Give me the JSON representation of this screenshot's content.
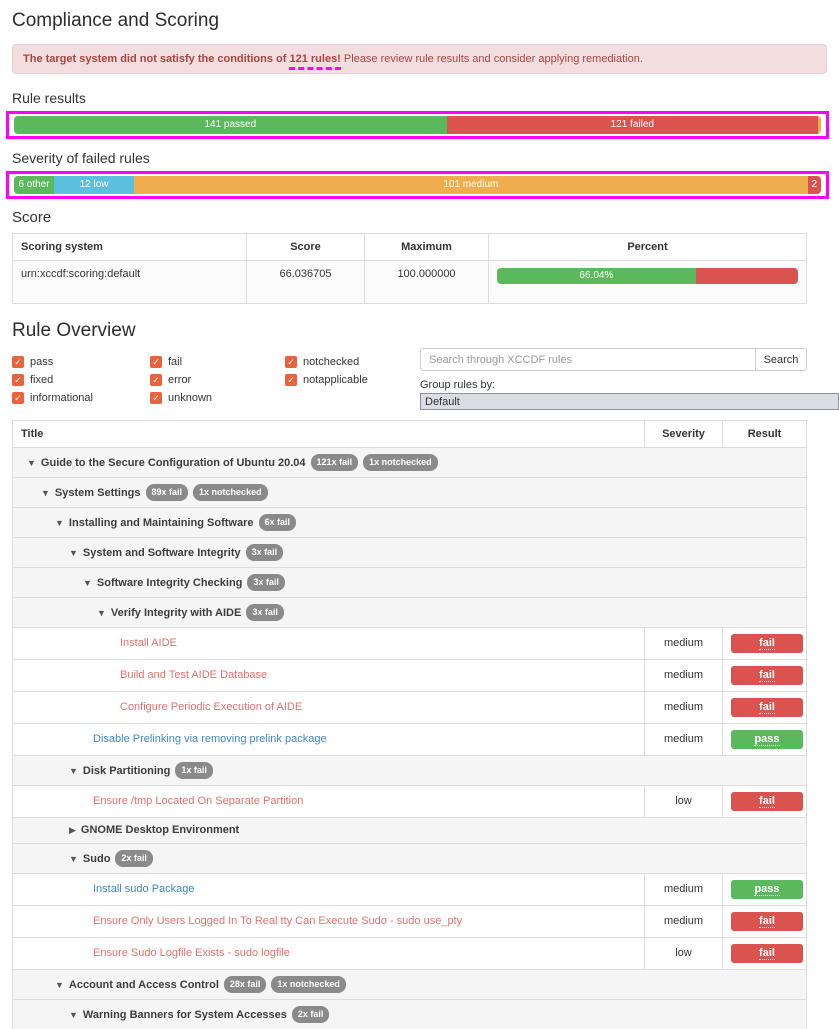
{
  "page_title": "Compliance and Scoring",
  "colors": {
    "pass_green": "#5cb85c",
    "fail_red": "#d9534f",
    "warning_orange": "#f0ad4e",
    "info_blue": "#5bc0de",
    "checkbox_orange": "#e8643c",
    "annotation_magenta": "#ff00ff",
    "badge_gray": "#8a8a8a",
    "alert_bg": "#f2dede",
    "alert_border": "#ebccd1",
    "alert_text": "#a94442",
    "link_fail": "#e4716e",
    "link_pass": "#4186c5"
  },
  "alert": {
    "bold_prefix": "The target system did not satisfy the conditions of ",
    "highlighted": "121 rules!",
    "rest": " Please review rule results and consider applying remediation."
  },
  "sections": {
    "rule_results": "Rule results",
    "severity": "Severity of failed rules",
    "score": "Score",
    "rule_overview": "Rule Overview"
  },
  "chart_data": [
    {
      "type": "bar",
      "variant": "horizontal-stacked",
      "title": "Rule results",
      "total": 263,
      "segments": [
        {
          "name": "passed",
          "label": "141 passed",
          "value": 141,
          "color_key": "pass_green"
        },
        {
          "name": "failed",
          "label": "121 failed",
          "value": 121,
          "color_key": "fail_red"
        },
        {
          "name": "other",
          "label": "",
          "value": 1,
          "color_key": "warning_orange"
        }
      ]
    },
    {
      "type": "bar",
      "variant": "horizontal-stacked",
      "title": "Severity of failed rules",
      "total": 121,
      "segments": [
        {
          "name": "other",
          "label": "6 other",
          "value": 6,
          "color_key": "pass_green"
        },
        {
          "name": "low",
          "label": "12 low",
          "value": 12,
          "color_key": "info_blue"
        },
        {
          "name": "medium",
          "label": "101 medium",
          "value": 101,
          "color_key": "warning_orange"
        },
        {
          "name": "high",
          "label": "2",
          "value": 2,
          "color_key": "fail_red"
        }
      ]
    }
  ],
  "score_table": {
    "headers": [
      "Scoring system",
      "Score",
      "Maximum",
      "Percent"
    ],
    "row": {
      "system": "urn:xccdf:scoring:default",
      "score": "66.036705",
      "maximum": "100.000000",
      "percent": 66.04,
      "percent_label": "66.04%"
    }
  },
  "rule_overview": {
    "filters": [
      "pass",
      "fixed",
      "informational",
      "fail",
      "error",
      "unknown",
      "notchecked",
      "notapplicable"
    ],
    "search_placeholder": "Search through XCCDF rules",
    "search_button": "Search",
    "group_by_label": "Group rules by:",
    "group_by_value": "Default"
  },
  "rule_table": {
    "headers": [
      "Title",
      "Severity",
      "Result"
    ],
    "rows": [
      {
        "type": "group",
        "level": 0,
        "collapsed": false,
        "title": "Guide to the Secure Configuration of Ubuntu 20.04",
        "badges": [
          "121x fail",
          "1x notchecked"
        ]
      },
      {
        "type": "group",
        "level": 1,
        "collapsed": false,
        "title": "System Settings",
        "badges": [
          "89x fail",
          "1x notchecked"
        ]
      },
      {
        "type": "group",
        "level": 2,
        "collapsed": false,
        "title": "Installing and Maintaining Software",
        "badges": [
          "6x fail"
        ]
      },
      {
        "type": "group",
        "level": 3,
        "collapsed": false,
        "title": "System and Software Integrity",
        "badges": [
          "3x fail"
        ]
      },
      {
        "type": "group",
        "level": 4,
        "collapsed": false,
        "title": "Software Integrity Checking",
        "badges": [
          "3x fail"
        ]
      },
      {
        "type": "group",
        "level": 5,
        "collapsed": false,
        "title": "Verify Integrity with AIDE",
        "badges": [
          "3x fail"
        ]
      },
      {
        "type": "leaf",
        "level": 6,
        "title": "Install AIDE",
        "severity": "medium",
        "result": "fail"
      },
      {
        "type": "leaf",
        "level": 6,
        "title": "Build and Test AIDE Database",
        "severity": "medium",
        "result": "fail"
      },
      {
        "type": "leaf",
        "level": 6,
        "title": "Configure Periodic Execution of AIDE",
        "severity": "medium",
        "result": "fail"
      },
      {
        "type": "leaf",
        "level": 4,
        "title": "Disable Prelinking via removing prelink package",
        "severity": "medium",
        "result": "pass"
      },
      {
        "type": "group",
        "level": 3,
        "collapsed": false,
        "title": "Disk Partitioning",
        "badges": [
          "1x fail"
        ]
      },
      {
        "type": "leaf",
        "level": 4,
        "title": "Ensure /tmp Located On Separate Partition",
        "severity": "low",
        "result": "fail"
      },
      {
        "type": "group",
        "level": 3,
        "collapsed": true,
        "title": "GNOME Desktop Environment",
        "badges": []
      },
      {
        "type": "group",
        "level": 3,
        "collapsed": false,
        "title": "Sudo",
        "badges": [
          "2x fail"
        ]
      },
      {
        "type": "leaf",
        "level": 4,
        "title": "Install sudo Package",
        "severity": "medium",
        "result": "pass"
      },
      {
        "type": "leaf",
        "level": 4,
        "title": "Ensure Only Users Logged In To Real tty Can Execute Sudo - sudo use_pty",
        "severity": "medium",
        "result": "fail"
      },
      {
        "type": "leaf",
        "level": 4,
        "title": "Ensure Sudo Logfile Exists - sudo logfile",
        "severity": "low",
        "result": "fail"
      },
      {
        "type": "group",
        "level": 2,
        "collapsed": false,
        "title": "Account and Access Control",
        "badges": [
          "28x fail",
          "1x notchecked"
        ]
      },
      {
        "type": "group",
        "level": 3,
        "collapsed": false,
        "title": "Warning Banners for System Accesses",
        "badges": [
          "2x fail"
        ]
      }
    ]
  }
}
